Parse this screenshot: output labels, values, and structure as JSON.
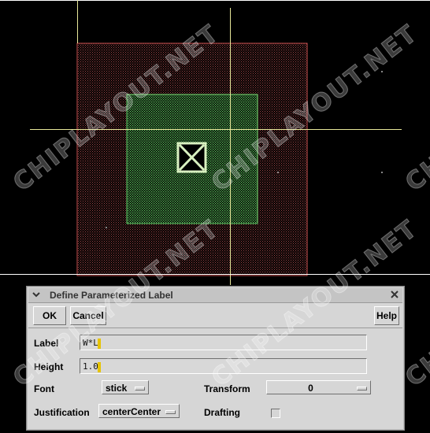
{
  "watermark": "CHIPLAYOUT.NET",
  "colors": {
    "canvas_bg": "#000000",
    "boundary": "#c85050",
    "diffusion": "#5fc85f",
    "crosshair": "#e8e89a",
    "contact": "#d8f0c0"
  },
  "dialog": {
    "title": "Define Parameterized Label",
    "menu_icon": "chevron-down-icon",
    "close_icon": "close-icon",
    "buttons": {
      "ok": "OK",
      "cancel": "Cancel",
      "help": "Help"
    },
    "label": {
      "label": "Label",
      "value": "W*L"
    },
    "height": {
      "label": "Height",
      "value": "1.0"
    },
    "font": {
      "label": "Font",
      "value": "stick"
    },
    "transform": {
      "label": "Transform",
      "value": "0"
    },
    "justification": {
      "label": "Justification",
      "value": "centerCenter"
    },
    "drafting": {
      "label": "Drafting",
      "checked": false
    }
  }
}
